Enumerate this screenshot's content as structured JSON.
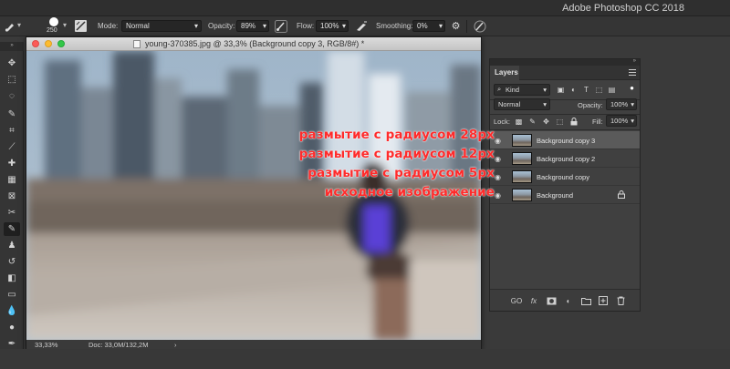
{
  "app": {
    "title": "Adobe Photoshop CC 2018"
  },
  "options_bar": {
    "brush_size": "250",
    "mode_label": "Mode:",
    "mode_value": "Normal",
    "opacity_label": "Opacity:",
    "opacity_value": "89%",
    "flow_label": "Flow:",
    "flow_value": "100%",
    "smoothing_label": "Smoothing:",
    "smoothing_value": "0%"
  },
  "toolbox": {
    "collapse_glyph": "»",
    "tools": [
      {
        "name": "move-tool",
        "glyph": "✥"
      },
      {
        "name": "marquee-tool",
        "glyph": "⬚"
      },
      {
        "name": "lasso-tool",
        "glyph": "◌"
      },
      {
        "name": "quick-select-tool",
        "glyph": "✎"
      },
      {
        "name": "crop-tool",
        "glyph": "⌗"
      },
      {
        "name": "eyedropper-tool",
        "glyph": "⟋"
      },
      {
        "name": "healing-tool",
        "glyph": "✚"
      },
      {
        "name": "patch-tool",
        "glyph": "▦"
      },
      {
        "name": "frame-tool",
        "glyph": "⊠"
      },
      {
        "name": "content-aware-move-tool",
        "glyph": "✂"
      },
      {
        "name": "brush-tool",
        "glyph": "✎",
        "active": true
      },
      {
        "name": "clone-stamp-tool",
        "glyph": "♟"
      },
      {
        "name": "history-brush-tool",
        "glyph": "↺"
      },
      {
        "name": "eraser-tool",
        "glyph": "◧"
      },
      {
        "name": "gradient-tool",
        "glyph": "▭"
      },
      {
        "name": "blur-tool",
        "glyph": "💧"
      },
      {
        "name": "dodge-tool",
        "glyph": "●"
      },
      {
        "name": "pen-tool",
        "glyph": "✒"
      },
      {
        "name": "type-tool",
        "glyph": "T"
      }
    ]
  },
  "document": {
    "title": "young-370385.jpg @ 33,3% (Background copy 3, RGB/8#) *",
    "zoom": "33,33%",
    "doc_info": "Doc: 33,0M/132,2M",
    "status_arrow": "›"
  },
  "layers_panel": {
    "collapse_glyph": "»",
    "tab_label": "Layers",
    "filter_kind": "Kind",
    "blend_mode": "Normal",
    "opacity_label": "Opacity:",
    "opacity_value": "100%",
    "lock_label": "Lock:",
    "fill_label": "Fill:",
    "fill_value": "100%",
    "layers": [
      {
        "name": "Background copy 3",
        "selected": true,
        "locked": false
      },
      {
        "name": "Background copy 2",
        "selected": false,
        "locked": false
      },
      {
        "name": "Background copy",
        "selected": false,
        "locked": false
      },
      {
        "name": "Background",
        "selected": false,
        "locked": true
      }
    ],
    "footer_link_label": "GO",
    "footer_fx_label": "fx"
  },
  "annotations": [
    "размытие с радиусом 28px",
    "размытие с радиусом 12px",
    "размытие с радиусом 5px",
    "исходное изображение"
  ],
  "colors": {
    "annotation": "#ff2b2b",
    "app_bg": "#3a3a3a",
    "selected_layer": "#5a5a5a"
  }
}
